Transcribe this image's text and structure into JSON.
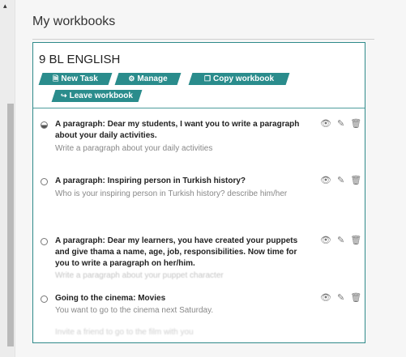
{
  "page": {
    "title": "My workbooks"
  },
  "workbook": {
    "title": "9 BL ENGLISH",
    "buttons": {
      "new_task": "New Task",
      "manage": "Manage",
      "copy_workbook": "Copy workbook",
      "leave_workbook": "Leave workbook"
    }
  },
  "tasks": [
    {
      "title": "A paragraph: Dear my students, I want you to write a paragraph about your daily activities.",
      "subtitle": "Write a paragraph about your daily activities"
    },
    {
      "title": "A paragraph: Inspiring person in Turkish history?",
      "subtitle": "Who is your inspiring person in Turkish history? describe him/her"
    },
    {
      "title": "A paragraph: Dear my learners, you have created your puppets and give thama a name, age, job, responsibilities. Now time for you to write a paragraph on her/him.",
      "subtitle": "Write a paragraph about your puppet character"
    },
    {
      "title": "Going to the cinema: Movies",
      "subtitle": "You want to go to the cinema next Saturday."
    }
  ],
  "faded_text": "Invite a friend to go to the film with you",
  "icons": {
    "view": "eye-icon",
    "edit": "pencil-icon",
    "delete": "trash-icon",
    "new_task": "document-icon",
    "manage": "gear-icon",
    "copy": "copy-icon",
    "leave": "exit-icon"
  },
  "colors": {
    "accent": "#2a8c8c",
    "card_border": "#2f8a8a"
  }
}
